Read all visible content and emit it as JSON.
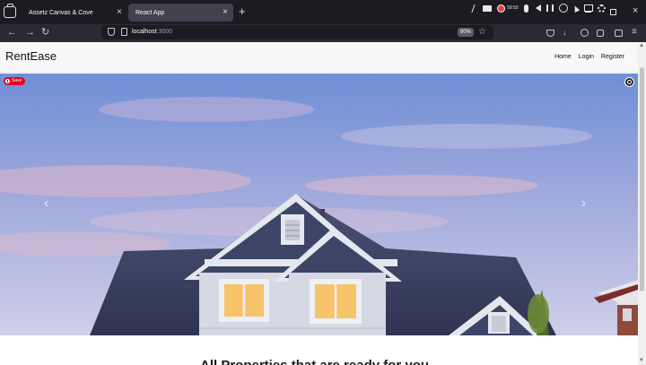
{
  "browser": {
    "tabs": [
      {
        "title": "Assetz Canvas & Cove",
        "active": false
      },
      {
        "title": "React App",
        "active": true
      }
    ],
    "new_tab_icon": "+",
    "tab_close_icon": "×",
    "address": {
      "host": "localhost",
      "port": ":3000"
    },
    "zoom": "90%",
    "recording_label": "59:50",
    "nav_icons": [
      "back-arrow-icon",
      "forward-arrow-icon",
      "reload-icon"
    ],
    "toolbar_icons": [
      "pocket-icon",
      "download-icon",
      "account-icon",
      "extensions-icon",
      "sync-icon",
      "menu-icon"
    ]
  },
  "site": {
    "brand": "RentEase",
    "nav": [
      "Home",
      "Login",
      "Register"
    ]
  },
  "hero": {
    "save_badge": "Save",
    "prev_arrow": "‹",
    "next_arrow": "›",
    "colors": {
      "sky_top": "#6f8fd6",
      "sky_bottom": "#c7c9e6",
      "roof": "#3a4160",
      "trim": "#e4e7ee",
      "window_light": "#f7c36b"
    }
  },
  "main": {
    "headline": "All Properties that are ready for you"
  }
}
